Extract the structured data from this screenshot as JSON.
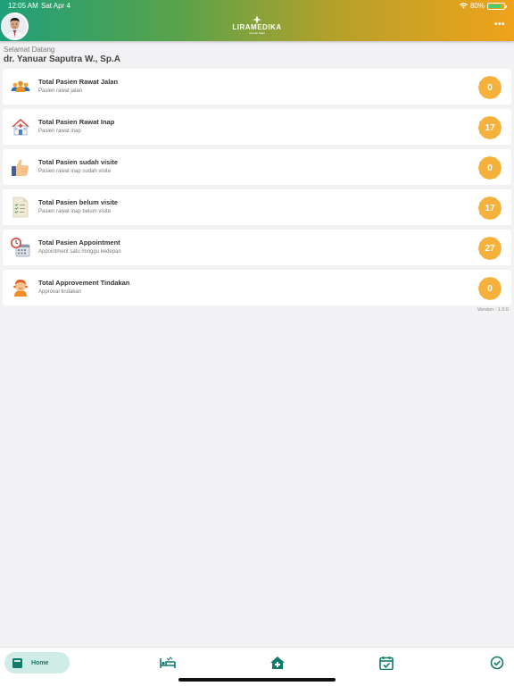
{
  "status_bar": {
    "time": "12:05 AM",
    "date": "Sat Apr 4",
    "battery": "80%",
    "battery_level": 0.8
  },
  "header": {
    "logo_text": "LIRAMEDIKA",
    "logo_subtitle": "Rumah Sakit",
    "menu_label": "•••",
    "accent_start": "#1fa07a",
    "accent_end": "#f0a21a"
  },
  "greeting": {
    "label": "Selamat Datang",
    "name": "dr. Yanuar Saputra W., Sp.A"
  },
  "cards": [
    {
      "icon": "people-group-icon",
      "title": "Total Pasien Rawat Jalan",
      "subtitle": "Pasien rawat jalan",
      "value": "0"
    },
    {
      "icon": "hospital-house-icon",
      "title": "Total Pasien Rawat Inap",
      "subtitle": "Pasien rawat inap",
      "value": "17"
    },
    {
      "icon": "thumbs-up-icon",
      "title": "Total Pasien sudah visite",
      "subtitle": "Pasien rawat inap sudah visite",
      "value": "0"
    },
    {
      "icon": "checklist-document-icon",
      "title": "Total Pasien belum visite",
      "subtitle": "Pasien rawat inap belum visite",
      "value": "17"
    },
    {
      "icon": "calendar-clock-icon",
      "title": "Total Pasien Appointment",
      "subtitle": "Appointment satu minggu kedepan",
      "value": "27"
    },
    {
      "icon": "person-approval-icon",
      "title": "Total Approvement Tindakan",
      "subtitle": "Approval tindakan",
      "value": "0"
    }
  ],
  "version": "Version : 1.0.0",
  "badge_color": "#f5b13c",
  "bottom_nav": {
    "home_label": "Home",
    "items": [
      "home-tab",
      "bed-tab",
      "hospital-tab",
      "calendar-check-tab",
      "check-circle-tab"
    ]
  }
}
